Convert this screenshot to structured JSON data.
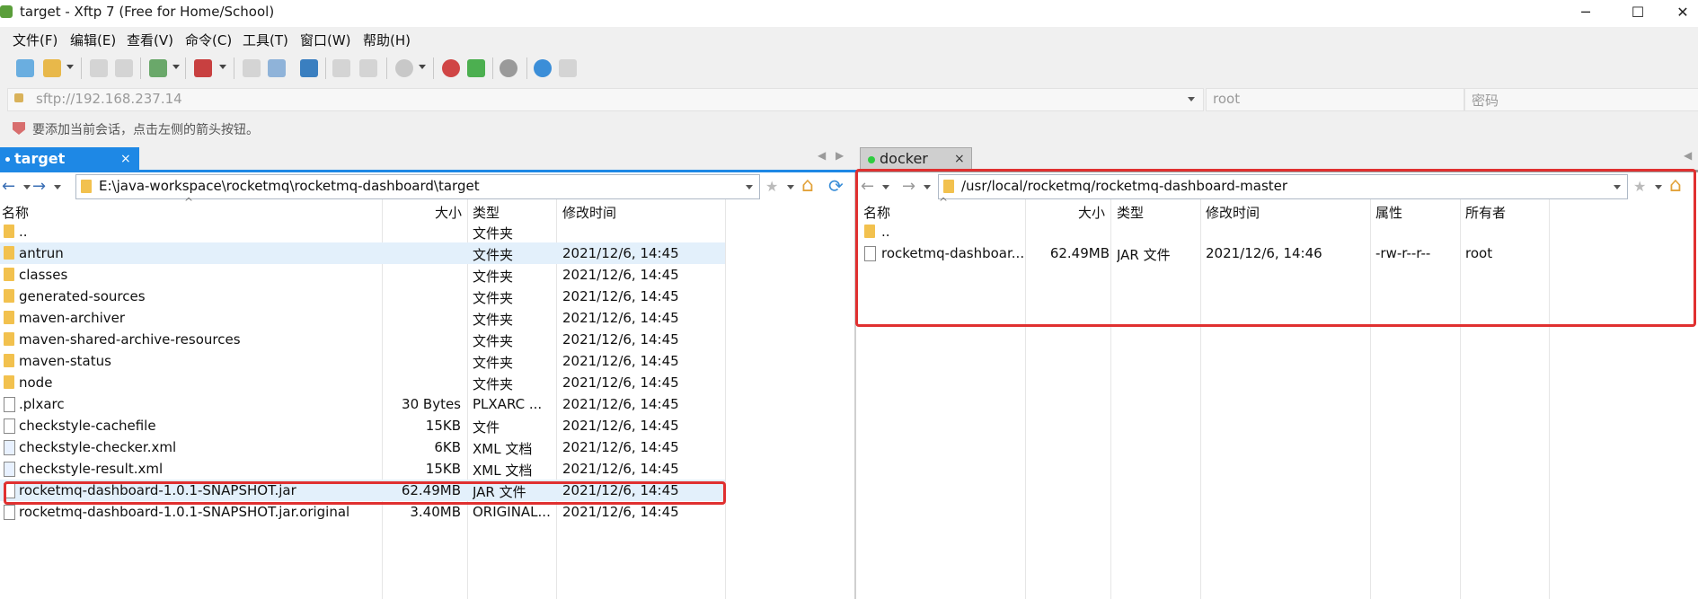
{
  "window": {
    "title": "target - Xftp 7 (Free for Home/School)",
    "controls": [
      "─",
      "☐",
      "✕"
    ]
  },
  "menu": [
    "文件(F)",
    "编辑(E)",
    "查看(V)",
    "命令(C)",
    "工具(T)",
    "窗口(W)",
    "帮助(H)"
  ],
  "address": {
    "url": "sftp://192.168.237.14",
    "user_placeholder": "root",
    "password_placeholder": "密码"
  },
  "hint": "要添加当前会话，点击左侧的箭头按钮。",
  "tabs": {
    "left": {
      "label": "target",
      "close": "×"
    },
    "right": {
      "label": "docker",
      "close": "×"
    }
  },
  "left_pane": {
    "path": "E:\\java-workspace\\rocketmq\\rocketmq-dashboard\\target",
    "columns": [
      "名称",
      "大小",
      "类型",
      "修改时间"
    ],
    "rows": [
      {
        "name": "..",
        "size": "",
        "type": "文件夹",
        "modified": "",
        "icon": "folder"
      },
      {
        "name": "antrun",
        "size": "",
        "type": "文件夹",
        "modified": "2021/12/6, 14:45",
        "icon": "folder"
      },
      {
        "name": "classes",
        "size": "",
        "type": "文件夹",
        "modified": "2021/12/6, 14:45",
        "icon": "folder"
      },
      {
        "name": "generated-sources",
        "size": "",
        "type": "文件夹",
        "modified": "2021/12/6, 14:45",
        "icon": "folder"
      },
      {
        "name": "maven-archiver",
        "size": "",
        "type": "文件夹",
        "modified": "2021/12/6, 14:45",
        "icon": "folder"
      },
      {
        "name": "maven-shared-archive-resources",
        "size": "",
        "type": "文件夹",
        "modified": "2021/12/6, 14:45",
        "icon": "folder"
      },
      {
        "name": "maven-status",
        "size": "",
        "type": "文件夹",
        "modified": "2021/12/6, 14:45",
        "icon": "folder"
      },
      {
        "name": "node",
        "size": "",
        "type": "文件夹",
        "modified": "2021/12/6, 14:45",
        "icon": "folder"
      },
      {
        "name": ".plxarc",
        "size": "30 Bytes",
        "type": "PLXARC ...",
        "modified": "2021/12/6, 14:45",
        "icon": "file"
      },
      {
        "name": "checkstyle-cachefile",
        "size": "15KB",
        "type": "文件",
        "modified": "2021/12/6, 14:45",
        "icon": "file"
      },
      {
        "name": "checkstyle-checker.xml",
        "size": "6KB",
        "type": "XML 文档",
        "modified": "2021/12/6, 14:45",
        "icon": "xml"
      },
      {
        "name": "checkstyle-result.xml",
        "size": "15KB",
        "type": "XML 文档",
        "modified": "2021/12/6, 14:45",
        "icon": "xml"
      },
      {
        "name": "rocketmq-dashboard-1.0.1-SNAPSHOT.jar",
        "size": "62.49MB",
        "type": "JAR 文件",
        "modified": "2021/12/6, 14:45",
        "icon": "file"
      },
      {
        "name": "rocketmq-dashboard-1.0.1-SNAPSHOT.jar.original",
        "size": "3.40MB",
        "type": "ORIGINAL...",
        "modified": "2021/12/6, 14:45",
        "icon": "file"
      }
    ]
  },
  "right_pane": {
    "path": "/usr/local/rocketmq/rocketmq-dashboard-master",
    "columns": [
      "名称",
      "大小",
      "类型",
      "修改时间",
      "属性",
      "所有者"
    ],
    "rows": [
      {
        "name": "..",
        "size": "",
        "type": "",
        "modified": "",
        "attrs": "",
        "owner": "",
        "icon": "folder"
      },
      {
        "name": "rocketmq-dashboar...",
        "size": "62.49MB",
        "type": "JAR 文件",
        "modified": "2021/12/6, 14:46",
        "attrs": "-rw-r--r--",
        "owner": "root",
        "icon": "file"
      }
    ]
  },
  "icons": {
    "nav_back": "←",
    "nav_forward": "→",
    "star": "★",
    "home": "⌂",
    "refresh": "⟳",
    "sort_asc": "^"
  },
  "colors": {
    "accent": "#1e88e5",
    "highlight_box": "#e03030",
    "folder": "#f2c14e",
    "selected_row": "#e3f0fb"
  }
}
